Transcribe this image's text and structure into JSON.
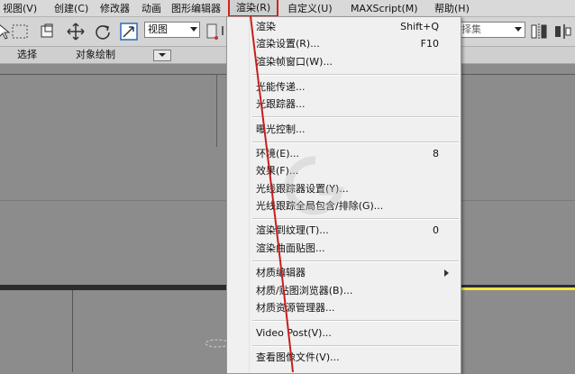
{
  "menubar": {
    "items": [
      {
        "label": "视图(V)"
      },
      {
        "label": "创建(C)"
      },
      {
        "label": "修改器"
      },
      {
        "label": "动画"
      },
      {
        "label": "图形编辑器"
      },
      {
        "label": "渲染(R)"
      },
      {
        "label": "自定义(U)"
      },
      {
        "label": "MAXScript(M)"
      },
      {
        "label": "帮助(H)"
      }
    ]
  },
  "toolbar": {
    "view_select": "视图",
    "selection_set": "择集"
  },
  "ribbon": {
    "tabs": [
      {
        "label": "选择"
      },
      {
        "label": "对象绘制"
      }
    ]
  },
  "render_menu": {
    "items": [
      {
        "label": "渲染",
        "shortcut": "Shift+Q"
      },
      {
        "label": "渲染设置(R)...",
        "shortcut": "F10"
      },
      {
        "label": "渲染帧窗口(W)..."
      },
      {
        "label": "光能传递..."
      },
      {
        "label": "光跟踪器..."
      },
      {
        "label": "曝光控制..."
      },
      {
        "label": "环境(E)...",
        "shortcut": "8"
      },
      {
        "label": "效果(F)..."
      },
      {
        "label": "光线跟踪器设置(Y)..."
      },
      {
        "label": "光线跟踪全局包含/排除(G)..."
      },
      {
        "label": "渲染到纹理(T)...",
        "shortcut": "0"
      },
      {
        "label": "渲染曲面贴图..."
      },
      {
        "label": "材质编辑器",
        "submenu": true
      },
      {
        "label": "材质/贴图浏览器(B)..."
      },
      {
        "label": "材质资源管理器..."
      },
      {
        "label": "Video Post(V)..."
      },
      {
        "label": "查看图像文件(V)..."
      }
    ]
  },
  "colors": {
    "highlight_box": "#d32020",
    "annotation_line": "#c81e1e",
    "viewport_active": "#f2e640"
  }
}
